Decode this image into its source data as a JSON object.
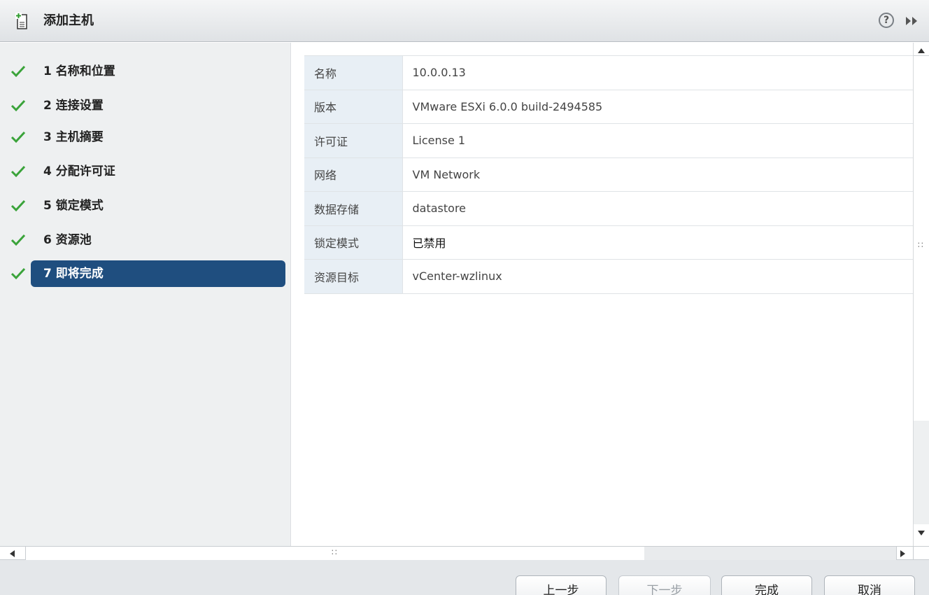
{
  "header": {
    "title": "添加主机",
    "help_glyph": "?"
  },
  "nav": {
    "items": [
      {
        "label": "1  名称和位置"
      },
      {
        "label": "2  连接设置"
      },
      {
        "label": "3  主机摘要"
      },
      {
        "label": "4  分配许可证"
      },
      {
        "label": "5  锁定模式"
      },
      {
        "label": "6  资源池"
      },
      {
        "label": "7  即将完成"
      }
    ]
  },
  "summary": {
    "rows": [
      {
        "key": "名称",
        "value": "10.0.0.13"
      },
      {
        "key": "版本",
        "value": "VMware ESXi 6.0.0 build-2494585"
      },
      {
        "key": "许可证",
        "value": "License 1"
      },
      {
        "key": "网络",
        "value": "VM Network"
      },
      {
        "key": "数据存储",
        "value": "datastore"
      },
      {
        "key": "锁定模式",
        "value": "已禁用"
      },
      {
        "key": "资源目标",
        "value": "vCenter-wzlinux"
      }
    ]
  },
  "footer": {
    "back_label": "上一步",
    "next_label": "下一步",
    "finish_label": "完成",
    "cancel_label": "取消"
  },
  "colors": {
    "active_nav": "#1f4e7f",
    "check": "#3aa33a",
    "key_cell_bg": "#e8eff5"
  }
}
